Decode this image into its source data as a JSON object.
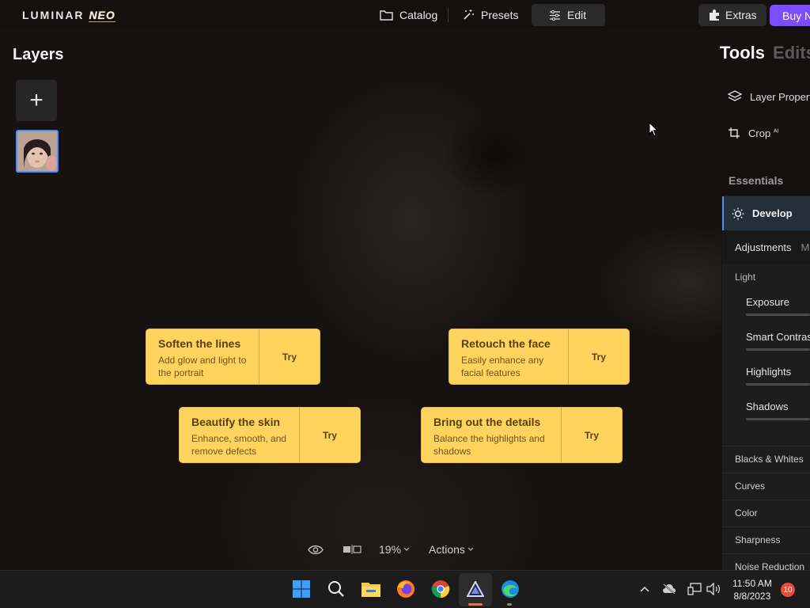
{
  "app": {
    "logo_main": "LUMINAR",
    "logo_neo": "NEO"
  },
  "topnav": {
    "catalog": "Catalog",
    "presets": "Presets",
    "edit": "Edit",
    "extras": "Extras",
    "buy": "Buy N"
  },
  "layers": {
    "title": "Layers",
    "add_label": "+"
  },
  "cards": [
    {
      "title": "Soften the lines",
      "desc": "Add glow and light to the portrait",
      "try": "Try"
    },
    {
      "title": "Retouch the face",
      "desc": "Easily enhance any facial features",
      "try": "Try"
    },
    {
      "title": "Beautify the skin",
      "desc": "Enhance, smooth, and remove defects",
      "try": "Try"
    },
    {
      "title": "Bring out the details",
      "desc": "Balance the highlights and shadows",
      "try": "Try"
    }
  ],
  "canvas_toolbar": {
    "zoom": "19%",
    "actions": "Actions"
  },
  "right_panel": {
    "tab_tools": "Tools",
    "tab_edits": "Edits",
    "layer_properties": "Layer Propert",
    "crop": "Crop",
    "crop_badge": "AI",
    "essentials": "Essentials",
    "develop": "Develop",
    "adjustments": "Adjustments",
    "adjustments_extra": "M",
    "light": "Light",
    "sliders": [
      "Exposure",
      "Smart Contras",
      "Highlights",
      "Shadows"
    ],
    "sections": [
      "Blacks & Whites",
      "Curves",
      "Color",
      "Sharpness",
      "Noise Reduction"
    ]
  },
  "taskbar": {
    "time": "11:50 AM",
    "date": "8/8/2023",
    "notifications": "10"
  }
}
